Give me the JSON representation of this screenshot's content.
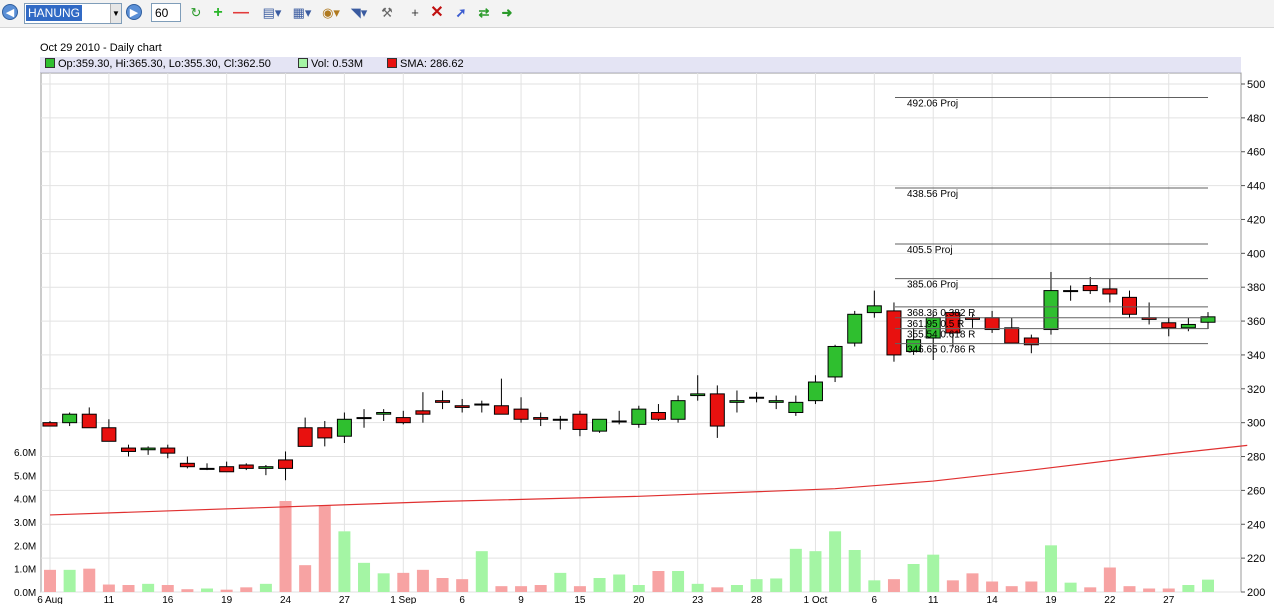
{
  "toolbar": {
    "symbol": "HANUNG",
    "period": "60"
  },
  "colors": {
    "up": "#2fbf2f",
    "down": "#e8110f",
    "vol_up": "#a4f5a4",
    "vol_down": "#f7a3a3",
    "sma": "#e03030",
    "grid": "#e2e2e2",
    "legend_bg": "#e4e4f4"
  },
  "chart_data": {
    "type": "candlestick",
    "title": "Oct 29 2010 - Daily chart",
    "legend": {
      "ohlc": "Op:359.30, Hi:365.30, Lo:355.30, Cl:362.50",
      "vol": "Vol: 0.53M",
      "sma": "SMA: 286.62"
    },
    "price_axis": {
      "min": 200,
      "max": 500,
      "step": 20,
      "ticks": [
        "200",
        "220",
        "240",
        "260",
        "280",
        "300",
        "320",
        "340",
        "360",
        "380",
        "400",
        "420",
        "440",
        "460",
        "480",
        "500"
      ]
    },
    "volume_axis": {
      "min": 0,
      "max": 6.0,
      "ticks": [
        "0.0M",
        "1.0M",
        "2.0M",
        "3.0M",
        "4.0M",
        "5.0M",
        "6.0M"
      ]
    },
    "x_ticks": [
      "6 Aug",
      "11",
      "16",
      "19",
      "24",
      "27",
      "1 Sep",
      "6",
      "9",
      "15",
      "20",
      "23",
      "28",
      "1 Oct",
      "6",
      "11",
      "14",
      "19",
      "22",
      "27"
    ],
    "x_tick_index": [
      0,
      3,
      6,
      9,
      12,
      15,
      18,
      21,
      24,
      27,
      30,
      33,
      36,
      39,
      42,
      45,
      48,
      51,
      54,
      57
    ],
    "bars": [
      [
        300,
        301,
        298,
        298,
        0.95
      ],
      [
        300,
        306,
        298,
        305,
        0.95
      ],
      [
        305,
        309,
        299,
        297,
        1.0
      ],
      [
        297,
        302,
        290,
        289,
        0.32
      ],
      [
        285,
        287,
        280,
        283,
        0.3
      ],
      [
        284,
        286,
        281,
        285,
        0.35
      ],
      [
        285,
        287,
        279,
        282,
        0.3
      ],
      [
        276,
        280,
        273,
        274,
        0.12
      ],
      [
        273,
        276,
        272,
        273,
        0.15
      ],
      [
        274,
        277,
        273,
        271,
        0.1
      ],
      [
        275,
        276,
        272,
        273,
        0.2
      ],
      [
        273,
        275,
        269,
        274,
        0.35
      ],
      [
        278,
        283,
        266,
        273,
        3.9
      ],
      [
        297,
        303,
        290,
        286,
        1.15
      ],
      [
        297,
        301,
        286,
        291,
        3.7
      ],
      [
        292,
        306,
        288,
        302,
        2.6
      ],
      [
        303,
        308,
        297,
        303,
        1.25
      ],
      [
        305,
        308,
        301,
        306,
        0.8
      ],
      [
        303,
        307,
        299,
        300,
        0.82
      ],
      [
        307,
        318,
        300,
        305,
        0.95
      ],
      [
        313,
        319,
        308,
        312,
        0.6
      ],
      [
        310,
        314,
        306,
        309,
        0.55
      ],
      [
        311,
        313,
        306,
        311,
        1.75
      ],
      [
        310,
        326,
        306,
        305,
        0.25
      ],
      [
        308,
        315,
        300,
        302,
        0.25
      ],
      [
        303,
        306,
        298,
        302,
        0.3
      ],
      [
        302,
        304,
        296,
        302,
        0.82
      ],
      [
        305,
        307,
        292,
        296,
        0.25
      ],
      [
        295,
        302,
        294,
        302,
        0.6
      ],
      [
        301,
        307,
        299,
        301,
        0.75
      ],
      [
        299,
        310,
        297,
        308,
        0.3
      ],
      [
        306,
        311,
        301,
        302,
        0.9
      ],
      [
        302,
        316,
        300,
        313,
        0.9
      ],
      [
        316,
        328,
        313,
        317,
        0.35
      ],
      [
        317,
        322,
        291,
        298,
        0.2
      ],
      [
        312,
        319,
        306,
        313,
        0.3
      ],
      [
        315,
        318,
        312,
        315,
        0.55
      ],
      [
        312,
        316,
        308,
        313,
        0.58
      ],
      [
        306,
        316,
        304,
        312,
        1.85
      ],
      [
        313,
        328,
        311,
        324,
        1.75
      ],
      [
        327,
        346,
        324,
        345,
        2.6
      ],
      [
        347,
        366,
        345,
        364,
        1.8
      ],
      [
        365,
        378,
        362,
        369,
        0.5
      ],
      [
        366,
        371,
        336,
        340,
        0.55
      ],
      [
        342,
        356,
        340,
        349,
        1.2
      ],
      [
        350,
        364,
        337,
        362,
        1.6
      ],
      [
        365,
        366,
        345,
        353,
        0.5
      ],
      [
        362,
        364,
        356,
        361,
        0.8
      ],
      [
        362,
        366,
        353,
        355,
        0.45
      ],
      [
        356,
        362,
        349,
        347,
        0.25
      ],
      [
        350,
        352,
        341,
        346,
        0.45
      ],
      [
        355,
        389,
        352,
        378,
        2.0
      ],
      [
        378,
        381,
        372,
        378,
        0.4
      ],
      [
        381,
        386,
        376,
        378,
        0.2
      ],
      [
        379,
        385,
        371,
        376,
        1.05
      ],
      [
        374,
        378,
        362,
        364,
        0.25
      ],
      [
        362,
        371,
        358,
        361,
        0.15
      ],
      [
        359,
        362,
        351,
        356,
        0.15
      ],
      [
        356,
        362,
        354,
        358,
        0.3
      ],
      [
        359.3,
        365.3,
        355.3,
        362.5,
        0.53
      ]
    ],
    "sma_points": [
      [
        0,
        245.5
      ],
      [
        10,
        249.5
      ],
      [
        20,
        253.5
      ],
      [
        30,
        256.5
      ],
      [
        40,
        261
      ],
      [
        45,
        265.5
      ],
      [
        50,
        272
      ],
      [
        55,
        279
      ],
      [
        61,
        286.6
      ]
    ],
    "projections": [
      {
        "value": 492.06,
        "text": "492.06   Proj"
      },
      {
        "value": 438.56,
        "text": "438.56   Proj"
      },
      {
        "value": 405.5,
        "text": "405.5   Proj"
      },
      {
        "value": 385.06,
        "text": "385.06   Proj"
      }
    ],
    "retracements": [
      {
        "value": 368.36,
        "text": "368.36 0.382 R"
      },
      {
        "value": 361.95,
        "text": "361.95 0.5 R"
      },
      {
        "value": 355.54,
        "text": "355.54 0.618 R"
      },
      {
        "value": 346.65,
        "text": "346.65 0.786 R"
      }
    ]
  }
}
